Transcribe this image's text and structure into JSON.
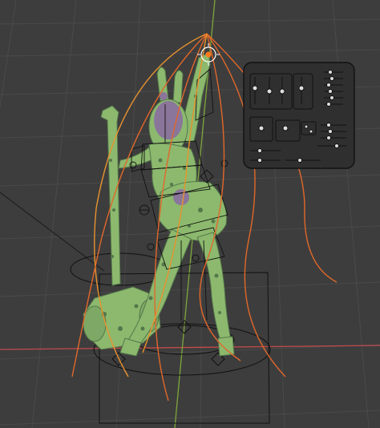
{
  "viewport": {
    "background": "#3d3d3d",
    "grid_color": "#4a4a4a",
    "axis_x_color": "#c44a4a",
    "axis_y_color": "#7ea83a",
    "curve_color": "#e2682a",
    "curve_color_light": "#e8922e",
    "mesh_color": "#8cb96e",
    "mesh_shadow": "#55774a",
    "mesh_purple": "#8a6aa3",
    "rig_line_color": "#111111"
  },
  "objects": {
    "figure": "character-mesh",
    "weapon": "hammer-mesh",
    "armature": "rig-armature",
    "light": "point-light-icon",
    "control_panel": "face-rig-control-panel"
  }
}
